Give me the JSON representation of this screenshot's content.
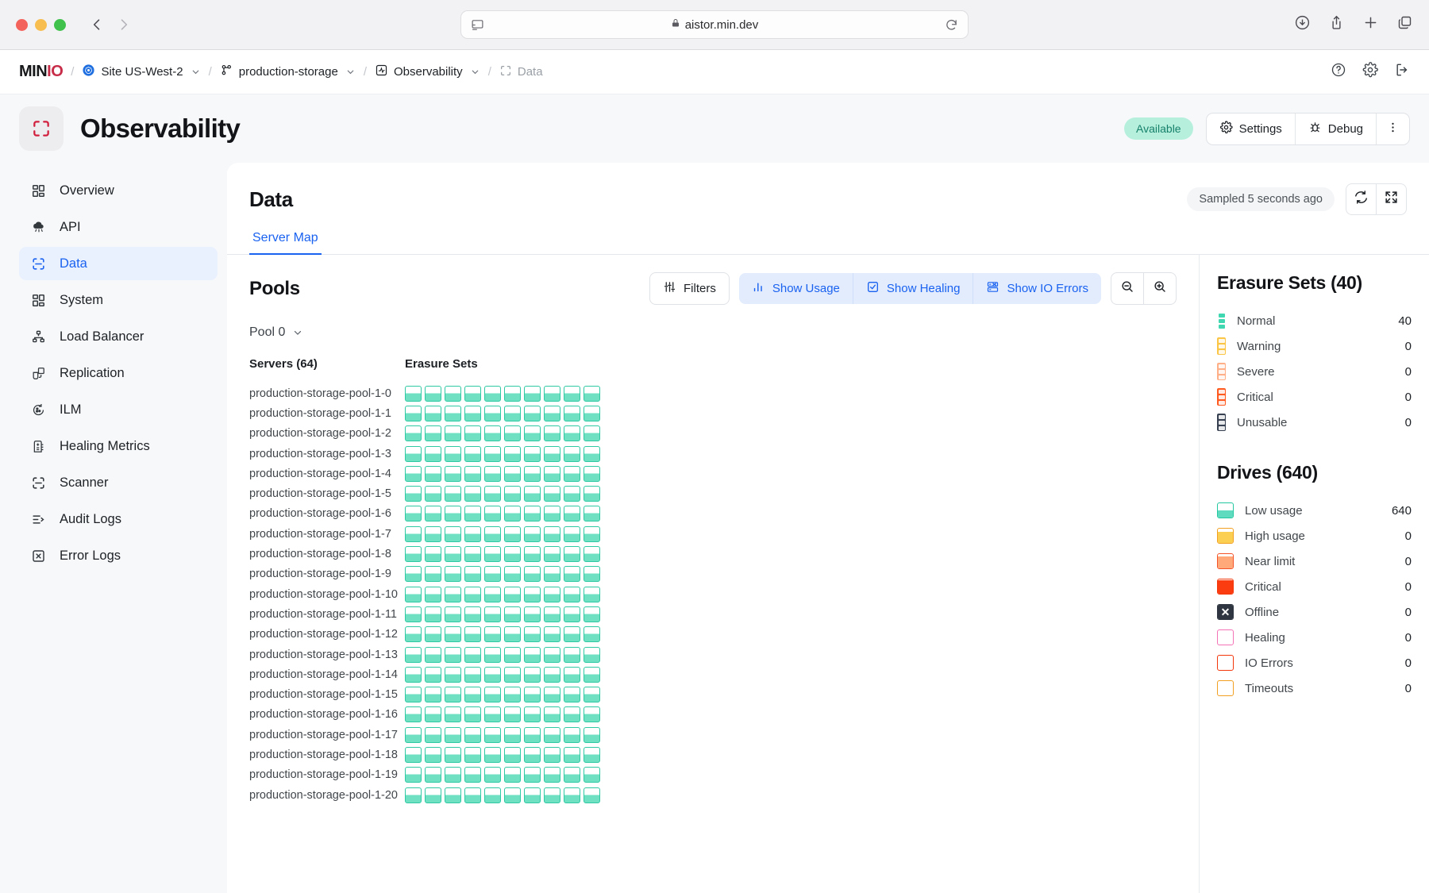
{
  "browser": {
    "url": "aistor.min.dev",
    "back_icon": "chevron-left-icon",
    "forward_icon": "chevron-right-icon",
    "sidebar_icon": "sidebar-toggle-icon",
    "reload_icon": "reload-icon",
    "lock_icon": "lock-icon",
    "right_icons": [
      "download-icon",
      "share-icon",
      "new-tab-icon",
      "tabs-icon"
    ]
  },
  "breadcrumb": {
    "logo_main": "MIN",
    "logo_accent": "IO",
    "items": [
      {
        "label": "Site US-West-2",
        "icon": "kubernetes-icon",
        "has_chevron": true,
        "dim": false
      },
      {
        "label": "production-storage",
        "icon": "cluster-icon",
        "has_chevron": true,
        "dim": false
      },
      {
        "label": "Observability",
        "icon": "activity-icon",
        "has_chevron": true,
        "dim": false
      },
      {
        "label": "Data",
        "icon": "scan-icon",
        "has_chevron": false,
        "dim": true
      }
    ],
    "separator": "/",
    "right_icons": [
      "help-icon",
      "gear-icon",
      "logout-icon"
    ]
  },
  "header": {
    "app_icon": "scan-icon",
    "title": "Observability",
    "status_badge": "Available",
    "settings_label": "Settings",
    "debug_label": "Debug",
    "settings_icon": "gear-icon",
    "debug_icon": "bug-icon",
    "more_icon": "more-vertical-icon"
  },
  "sidebar": {
    "items": [
      {
        "label": "Overview",
        "icon": "grid-icon",
        "active": false
      },
      {
        "label": "API",
        "icon": "cloud-icon",
        "active": false
      },
      {
        "label": "Data",
        "icon": "scan-icon",
        "active": true
      },
      {
        "label": "System",
        "icon": "grid-icon",
        "active": false
      },
      {
        "label": "Load Balancer",
        "icon": "network-icon",
        "active": false
      },
      {
        "label": "Replication",
        "icon": "replication-icon",
        "active": false
      },
      {
        "label": "ILM",
        "icon": "lifecycle-icon",
        "active": false
      },
      {
        "label": "Healing Metrics",
        "icon": "healing-icon",
        "active": false
      },
      {
        "label": "Scanner",
        "icon": "scan-icon",
        "active": false
      },
      {
        "label": "Audit Logs",
        "icon": "list-icon",
        "active": false
      },
      {
        "label": "Error Logs",
        "icon": "error-icon",
        "active": false
      }
    ]
  },
  "main": {
    "title": "Data",
    "sampled_text": "Sampled 5 seconds ago",
    "refresh_icon": "refresh-icon",
    "fullscreen_icon": "fullscreen-icon",
    "tabs": [
      {
        "label": "Server Map",
        "active": true
      }
    ],
    "pools_title": "Pools",
    "toolbar": {
      "filters_label": "Filters",
      "filters_icon": "filters-icon",
      "show_usage_label": "Show Usage",
      "show_usage_icon": "bar-chart-icon",
      "show_healing_label": "Show Healing",
      "show_healing_icon": "check-square-icon",
      "show_io_errors_label": "Show IO Errors",
      "show_io_errors_icon": "server-error-icon",
      "zoom_out_icon": "zoom-out-icon",
      "zoom_in_icon": "zoom-in-icon"
    },
    "pool_select": {
      "label": "Pool 0",
      "chevron": "chevron-down-icon"
    },
    "servers_header": "Servers (64)",
    "erasure_sets_header": "Erasure Sets",
    "erasure_sets_per_row": 10,
    "server_rows": [
      "production-storage-pool-1-0",
      "production-storage-pool-1-1",
      "production-storage-pool-1-2",
      "production-storage-pool-1-3",
      "production-storage-pool-1-4",
      "production-storage-pool-1-5",
      "production-storage-pool-1-6",
      "production-storage-pool-1-7",
      "production-storage-pool-1-8",
      "production-storage-pool-1-9",
      "production-storage-pool-1-10",
      "production-storage-pool-1-11",
      "production-storage-pool-1-12",
      "production-storage-pool-1-13",
      "production-storage-pool-1-14",
      "production-storage-pool-1-15",
      "production-storage-pool-1-16",
      "production-storage-pool-1-17",
      "production-storage-pool-1-18",
      "production-storage-pool-1-19",
      "production-storage-pool-1-20"
    ]
  },
  "right_panel": {
    "erasure_sets_title": "Erasure Sets (40)",
    "erasure_sets": [
      {
        "label": "Normal",
        "value": "40",
        "color": "#3fd8b0",
        "bg": "#ffffff"
      },
      {
        "label": "Warning",
        "value": "0",
        "color": "#f5a623",
        "bg": "#fbc546"
      },
      {
        "label": "Severe",
        "value": "0",
        "color": "#ff9a66",
        "bg": "#ffb088"
      },
      {
        "label": "Critical",
        "value": "0",
        "color": "#f4360b",
        "bg": "#ff5a1f"
      },
      {
        "label": "Unusable",
        "value": "0",
        "color": "#4b5563",
        "bg": "#374151"
      }
    ],
    "drives_title": "Drives (640)",
    "drives": [
      {
        "label": "Low usage",
        "value": "640",
        "border": "#23c8a0",
        "fill": "#5fdcc0",
        "fill_pct": 52,
        "x": false
      },
      {
        "label": "High usage",
        "value": "0",
        "border": "#f2a022",
        "fill": "#fbcf52",
        "fill_pct": 76,
        "x": false
      },
      {
        "label": "Near limit",
        "value": "0",
        "border": "#f4532a",
        "fill": "#ffa87a",
        "fill_pct": 84,
        "x": false
      },
      {
        "label": "Critical",
        "value": "0",
        "border": "#f4360b",
        "fill": "#fb3c10",
        "fill_pct": 92,
        "x": false
      },
      {
        "label": "Offline",
        "value": "0",
        "border": "#2f3641",
        "fill": "#2f3641",
        "fill_pct": 100,
        "x": true
      },
      {
        "label": "Healing",
        "value": "0",
        "border": "#f472b6",
        "fill": "#ffffff",
        "fill_pct": 0,
        "x": false
      },
      {
        "label": "IO Errors",
        "value": "0",
        "border": "#f4360b",
        "fill": "#ffffff",
        "fill_pct": 0,
        "x": false
      },
      {
        "label": "Timeouts",
        "value": "0",
        "border": "#f2a022",
        "fill": "#ffffff",
        "fill_pct": 0,
        "x": false
      }
    ]
  }
}
